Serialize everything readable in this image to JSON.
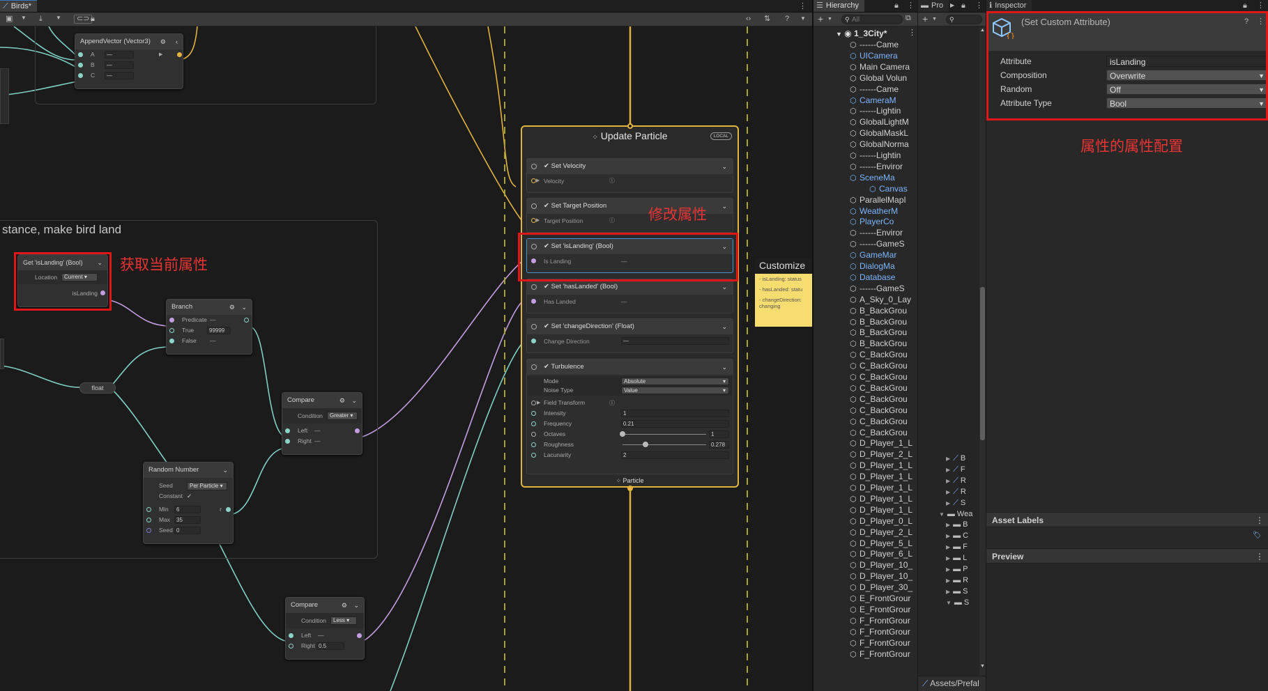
{
  "graph_window": {
    "tab_title": "Birds*",
    "toolbar_icons": [
      "save-icon",
      "dropdown-icon",
      "export-icon",
      "dropdown-icon",
      "link-icon",
      "lock-icon"
    ],
    "right_icons": [
      "code-icon",
      "sliders-icon",
      "help-icon",
      "dropdown-icon"
    ]
  },
  "group_note": {
    "title": "stance, make bird land"
  },
  "nodes": {
    "append_vector": {
      "title": "AppendVector (Vector3)",
      "ports": [
        "A",
        "B",
        "C"
      ],
      "values": [
        "—",
        "—",
        "—"
      ]
    },
    "get_islanding": {
      "title": "Get 'isLanding' (Bool)",
      "location_label": "Location",
      "location_value": "Current",
      "output_label": "isLanding"
    },
    "branch": {
      "title": "Branch",
      "predicate": "Predicate",
      "predicate_value": "—",
      "true_label": "True",
      "true_value": "99999",
      "false_label": "False",
      "false_value": "—"
    },
    "float_node": {
      "label": "float"
    },
    "compare1": {
      "title": "Compare",
      "condition_label": "Condition",
      "condition_value": "Greater",
      "left": "Left",
      "left_value": "—",
      "right": "Right",
      "right_value": "—"
    },
    "random_number": {
      "title": "Random Number",
      "seed_label": "Seed",
      "seed_value": "Per Particle",
      "constant_label": "Constant",
      "min_label": "Min",
      "min_value": "6",
      "max_label": "Max",
      "max_value": "35",
      "seed2_label": "Seed",
      "seed2_value": "0",
      "out_label": "r"
    },
    "compare2": {
      "title": "Compare",
      "condition_label": "Condition",
      "condition_value": "Less",
      "left": "Left",
      "left_value": "—",
      "right": "Right",
      "right_value": "0.5"
    }
  },
  "update_context": {
    "title": "Update Particle",
    "badge": "LOCAL",
    "footer": "Particle",
    "blocks": [
      {
        "title": "Set Velocity",
        "field": "Velocity",
        "value": ""
      },
      {
        "title": "Set Target Position",
        "field": "Target Position",
        "value": ""
      },
      {
        "title": "Set 'isLanding'  (Bool)",
        "field": "Is Landing",
        "value": "—"
      },
      {
        "title": "Set 'hasLanded'  (Bool)",
        "field": "Has Landed",
        "value": "—"
      },
      {
        "title": "Set 'changeDirection'  (Float)",
        "field": "Change Direction",
        "value": "—"
      }
    ],
    "turbulence": {
      "title": "Turbulence",
      "mode_label": "Mode",
      "mode_value": "Absolute",
      "noise_label": "Noise Type",
      "noise_value": "Value",
      "field_transform": "Field Transform",
      "rows": [
        {
          "label": "Intensity",
          "value": "1"
        },
        {
          "label": "Frequency",
          "value": "0.21"
        },
        {
          "label": "Octaves",
          "value": "1",
          "slider": 0.0
        },
        {
          "label": "Roughness",
          "value": "0.278",
          "slider": 0.278
        },
        {
          "label": "Lacunarity",
          "value": "2"
        }
      ]
    }
  },
  "sticky_note": {
    "title": "Customize",
    "lines": [
      "- isLanding: status",
      "- hasLanded: statu",
      "- changeDirection:",
      "changing"
    ]
  },
  "annotations": {
    "modify_attr": "修改属性",
    "get_current_attr": "获取当前属性",
    "attr_config": "属性的属性配置"
  },
  "hierarchy": {
    "tab": "Hierarchy",
    "search_placeholder": "All",
    "scene": "1_3City*",
    "items": [
      {
        "name": "------Came",
        "blue": false,
        "arrow": ""
      },
      {
        "name": "UICamera",
        "blue": true,
        "arrow": "▶"
      },
      {
        "name": "Main Camera",
        "blue": false,
        "arrow": ""
      },
      {
        "name": "Global Volun",
        "blue": false,
        "arrow": ""
      },
      {
        "name": "------Came",
        "blue": false,
        "arrow": ""
      },
      {
        "name": "CameraM",
        "blue": true,
        "arrow": "▶"
      },
      {
        "name": "------Lightin",
        "blue": false,
        "arrow": ""
      },
      {
        "name": "GlobalLightM",
        "blue": false,
        "arrow": ""
      },
      {
        "name": "GlobalMaskL",
        "blue": false,
        "arrow": ""
      },
      {
        "name": "GlobalNorma",
        "blue": false,
        "arrow": ""
      },
      {
        "name": "------Lightin",
        "blue": false,
        "arrow": ""
      },
      {
        "name": "------Enviror",
        "blue": false,
        "arrow": ""
      },
      {
        "name": "SceneMa",
        "blue": true,
        "arrow": "▼"
      },
      {
        "name": "Canvas",
        "blue": true,
        "arrow": "",
        "indent": true
      },
      {
        "name": "ParallelMapI",
        "blue": false,
        "arrow": ""
      },
      {
        "name": "WeatherM",
        "blue": true,
        "arrow": "▶"
      },
      {
        "name": "PlayerCo",
        "blue": true,
        "arrow": "▶"
      },
      {
        "name": "------Enviror",
        "blue": false,
        "arrow": ""
      },
      {
        "name": "------GameS",
        "blue": false,
        "arrow": ""
      },
      {
        "name": "GameMar",
        "blue": true,
        "arrow": ""
      },
      {
        "name": "DialogMa",
        "blue": true,
        "arrow": ""
      },
      {
        "name": "Database",
        "blue": true,
        "arrow": ""
      },
      {
        "name": "------GameS",
        "blue": false,
        "arrow": "▶"
      },
      {
        "name": "A_Sky_0_Lay",
        "blue": false,
        "arrow": ""
      },
      {
        "name": "B_BackGrou",
        "blue": false,
        "arrow": ""
      },
      {
        "name": "B_BackGrou",
        "blue": false,
        "arrow": ""
      },
      {
        "name": "B_BackGrou",
        "blue": false,
        "arrow": ""
      },
      {
        "name": "B_BackGrou",
        "blue": false,
        "arrow": ""
      },
      {
        "name": "C_BackGrou",
        "blue": false,
        "arrow": ""
      },
      {
        "name": "C_BackGrou",
        "blue": false,
        "arrow": ""
      },
      {
        "name": "C_BackGrou",
        "blue": false,
        "arrow": ""
      },
      {
        "name": "C_BackGrou",
        "blue": false,
        "arrow": ""
      },
      {
        "name": "C_BackGrou",
        "blue": false,
        "arrow": ""
      },
      {
        "name": "C_BackGrou",
        "blue": false,
        "arrow": ""
      },
      {
        "name": "C_BackGrou",
        "blue": false,
        "arrow": ""
      },
      {
        "name": "C_BackGrou",
        "blue": false,
        "arrow": ""
      },
      {
        "name": "D_Player_1_L",
        "blue": false,
        "arrow": ""
      },
      {
        "name": "D_Player_2_L",
        "blue": false,
        "arrow": ""
      },
      {
        "name": "D_Player_1_L",
        "blue": false,
        "arrow": ""
      },
      {
        "name": "D_Player_1_L",
        "blue": false,
        "arrow": ""
      },
      {
        "name": "D_Player_1_L",
        "blue": false,
        "arrow": ""
      },
      {
        "name": "D_Player_1_L",
        "blue": false,
        "arrow": ""
      },
      {
        "name": "D_Player_1_L",
        "blue": false,
        "arrow": ""
      },
      {
        "name": "D_Player_0_L",
        "blue": false,
        "arrow": ""
      },
      {
        "name": "D_Player_2_L",
        "blue": false,
        "arrow": ""
      },
      {
        "name": "D_Player_5_L",
        "blue": false,
        "arrow": ""
      },
      {
        "name": "D_Player_6_L",
        "blue": false,
        "arrow": ""
      },
      {
        "name": "D_Player_10_",
        "blue": false,
        "arrow": ""
      },
      {
        "name": "D_Player_10_",
        "blue": false,
        "arrow": ""
      },
      {
        "name": "D_Player_30_",
        "blue": false,
        "arrow": ""
      },
      {
        "name": "E_FrontGrour",
        "blue": false,
        "arrow": ""
      },
      {
        "name": "E_FrontGrour",
        "blue": false,
        "arrow": ""
      },
      {
        "name": "F_FrontGrour",
        "blue": false,
        "arrow": ""
      },
      {
        "name": "F_FrontGrour",
        "blue": false,
        "arrow": ""
      },
      {
        "name": "F_FrontGrour",
        "blue": false,
        "arrow": ""
      },
      {
        "name": "F_FrontGrour",
        "blue": false,
        "arrow": ""
      }
    ]
  },
  "project": {
    "tab": "Pro",
    "items": [
      {
        "label": "B",
        "type": "asset"
      },
      {
        "label": "F",
        "type": "asset"
      },
      {
        "label": "R",
        "type": "asset"
      },
      {
        "label": "R",
        "type": "asset"
      },
      {
        "label": "S",
        "type": "asset"
      },
      {
        "label": "Wea",
        "type": "folder-open"
      },
      {
        "label": "B",
        "type": "folder"
      },
      {
        "label": "C",
        "type": "folder"
      },
      {
        "label": "F",
        "type": "folder"
      },
      {
        "label": "L",
        "type": "folder"
      },
      {
        "label": "P",
        "type": "folder"
      },
      {
        "label": "R",
        "type": "folder"
      },
      {
        "label": "S",
        "type": "folder"
      },
      {
        "label": "S",
        "type": "folder-open"
      }
    ],
    "footer": "Assets/Prefal"
  },
  "inspector": {
    "tab": "Inspector",
    "title": "(Set Custom Attribute)",
    "props": [
      {
        "label": "Attribute",
        "value": "isLanding",
        "kind": "text"
      },
      {
        "label": "Composition",
        "value": "Overwrite",
        "kind": "dropdown"
      },
      {
        "label": "Random",
        "value": "Off",
        "kind": "dropdown"
      },
      {
        "label": "Attribute Type",
        "value": "Bool",
        "kind": "dropdown"
      }
    ],
    "asset_labels": "Asset Labels",
    "preview": "Preview"
  },
  "colors": {
    "red_highlight": "#e11717",
    "accent_blue": "#3a79bb",
    "context_border": "#e3b341",
    "sticky": "#f7dc6f",
    "edge_teal": "#7fd0c2",
    "edge_purple": "#c49ee3"
  }
}
